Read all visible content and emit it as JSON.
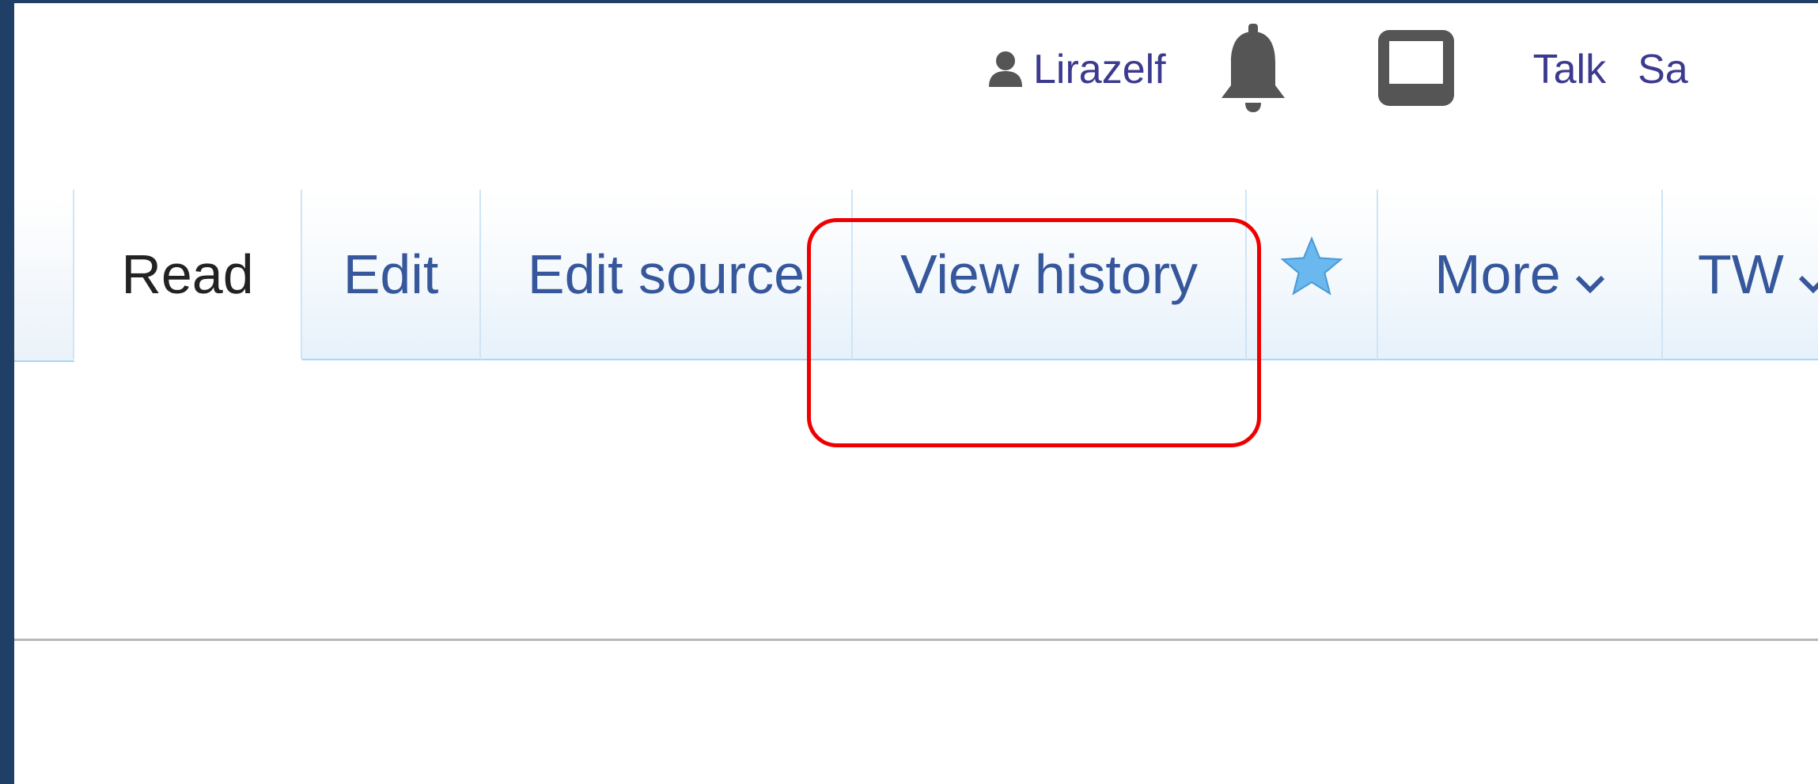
{
  "personal_tools": {
    "username": "Lirazelf",
    "user_icon": "user-icon",
    "notifications_icon": "bell-icon",
    "notices_icon": "inbox-icon",
    "talk_label": "Talk",
    "sandbox_label": "Sa"
  },
  "tabs": {
    "read": "Read",
    "edit": "Edit",
    "edit_source": "Edit source",
    "view_history": "View history",
    "watch_icon": "star-icon",
    "more": "More",
    "tw": "TW"
  },
  "colors": {
    "link": "#3c3a8e",
    "tab_text": "#36579b",
    "highlight": "#ee0000",
    "star": "#6bb8ee",
    "frame": "#1f3f66"
  }
}
